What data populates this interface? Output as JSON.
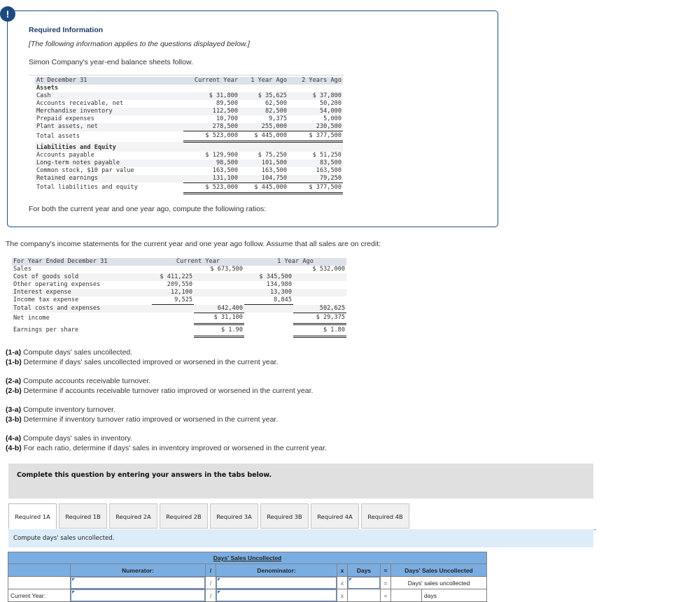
{
  "required_info": {
    "alert_icon": "!",
    "title": "Required Information",
    "note": "[The following information applies to the questions displayed below.]",
    "intro": "Simon Company's year-end balance sheets follow.",
    "balance_sheet": {
      "header": {
        "label": "At December 31",
        "cols": [
          "Current Year",
          "1 Year Ago",
          "2 Years Ago"
        ]
      },
      "assets_heading": "Assets",
      "assets": [
        {
          "label": "Cash",
          "values": [
            "$ 31,800",
            "$ 35,625",
            "$ 37,800"
          ]
        },
        {
          "label": "Accounts receivable, net",
          "values": [
            "89,500",
            "62,500",
            "50,200"
          ]
        },
        {
          "label": "Merchandise inventory",
          "values": [
            "112,500",
            "82,500",
            "54,000"
          ]
        },
        {
          "label": "Prepaid expenses",
          "values": [
            "10,700",
            "9,375",
            "5,000"
          ]
        },
        {
          "label": "Plant assets, net",
          "values": [
            "278,500",
            "255,000",
            "230,500"
          ]
        }
      ],
      "total_assets": {
        "label": "Total assets",
        "values": [
          "$ 523,000",
          "$ 445,000",
          "$ 377,500"
        ]
      },
      "liabilities_heading": "Liabilities and Equity",
      "liabilities": [
        {
          "label": "Accounts payable",
          "values": [
            "$ 129,900",
            "$ 75,250",
            "$ 51,250"
          ]
        },
        {
          "label": "Long-term notes payable",
          "values": [
            "98,500",
            "101,500",
            "83,500"
          ]
        },
        {
          "label": "Common stock, $10 par value",
          "values": [
            "163,500",
            "163,500",
            "163,500"
          ]
        },
        {
          "label": "Retained earnings",
          "values": [
            "131,100",
            "104,750",
            "79,250"
          ]
        }
      ],
      "total_liabilities": {
        "label": "Total liabilities and equity",
        "values": [
          "$ 523,000",
          "$ 445,000",
          "$ 377,500"
        ]
      }
    },
    "ratios_line": "For both the current year and one year ago, compute the following ratios:"
  },
  "income_statement": {
    "intro": "The company's income statements for the current year and one year ago follow. Assume that all sales are on credit:",
    "header": {
      "label": "For Year Ended December 31",
      "cols": [
        "Current Year",
        "1 Year Ago"
      ]
    },
    "sales": {
      "label": "Sales",
      "values": [
        "$ 673,500",
        "$ 532,000"
      ]
    },
    "expenses": [
      {
        "label": "Cost of goods sold",
        "values": [
          "$ 411,225",
          "$ 345,500"
        ]
      },
      {
        "label": "Other operating expenses",
        "values": [
          "209,550",
          "134,980"
        ]
      },
      {
        "label": "Interest expense",
        "values": [
          "12,100",
          "13,300"
        ]
      },
      {
        "label": "Income tax expense",
        "values": [
          "9,525",
          "8,845"
        ]
      }
    ],
    "total_costs": {
      "label": "Total costs and expenses",
      "values": [
        "642,400",
        "502,625"
      ]
    },
    "net_income": {
      "label": "Net income",
      "values": [
        "$ 31,100",
        "$ 29,375"
      ]
    },
    "eps": {
      "label": "Earnings per share",
      "values": [
        "$ 1.90",
        "$ 1.80"
      ]
    }
  },
  "questions": [
    {
      "tag": "(1-a)",
      "text": " Compute days' sales uncollected."
    },
    {
      "tag": "(1-b)",
      "text": " Determine if days' sales uncollected improved or worsened in the current year."
    },
    {
      "tag": "(2-a)",
      "text": " Compute accounts receivable turnover."
    },
    {
      "tag": "(2-b)",
      "text": " Determine if accounts receivable turnover ratio improved or worsened in the current year."
    },
    {
      "tag": "(3-a)",
      "text": " Compute inventory turnover."
    },
    {
      "tag": "(3-b)",
      "text": " Determine if inventory turnover ratio improved or worsened in the current year."
    },
    {
      "tag": "(4-a)",
      "text": " Compute days' sales in inventory."
    },
    {
      "tag": "(4-b)",
      "text": " For each ratio, determine if days' sales in inventory improved or worsened in the current year."
    }
  ],
  "complete_prompt": "Complete this question by entering your answers in the tabs below.",
  "tabs": [
    {
      "label": "Required 1A",
      "active": true
    },
    {
      "label": "Required 1B"
    },
    {
      "label": "Required 2A"
    },
    {
      "label": "Required 2B"
    },
    {
      "label": "Required 3A"
    },
    {
      "label": "Required 3B"
    },
    {
      "label": "Required 4A"
    },
    {
      "label": "Required 4B"
    }
  ],
  "instruction": "Compute days' sales uncollected.",
  "answer_table": {
    "title": "Days' Sales Uncollected",
    "headers": {
      "numerator": "Numerator:",
      "div": "/",
      "denominator": "Denominator:",
      "times": "x",
      "days": "Days",
      "eq": "=",
      "result": "Days' Sales Uncollected"
    },
    "formula_row": {
      "div": "/",
      "times": "x",
      "eq": "=",
      "result": "Days' sales uncollected"
    },
    "rows": [
      {
        "label": "Current Year:",
        "div": "/",
        "times": "x",
        "eq": "=",
        "unit": "days"
      }
    ]
  },
  "colors": {
    "accent": "#1c4a80",
    "table_header": "#7aaee3",
    "instruction_bg": "#dcecf8"
  }
}
